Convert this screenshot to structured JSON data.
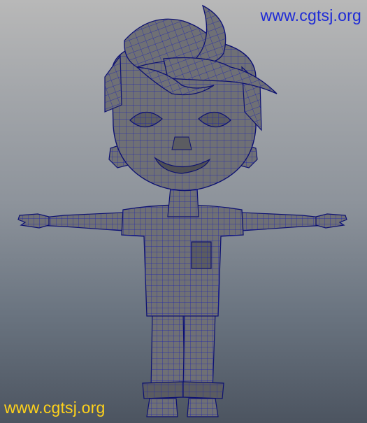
{
  "viewport": {
    "watermark_top": "www.cgtsj.org",
    "watermark_bottom": "www.cgtsj.org",
    "subject": "character-wireframe-model"
  },
  "colors": {
    "watermark_top": "#1f2bd6",
    "watermark_bottom": "#ffd21a",
    "mesh_fill": "#6f7075",
    "mesh_shade": "#5b5c61",
    "wire": "#1c22b0",
    "outline": "#0d1170"
  }
}
